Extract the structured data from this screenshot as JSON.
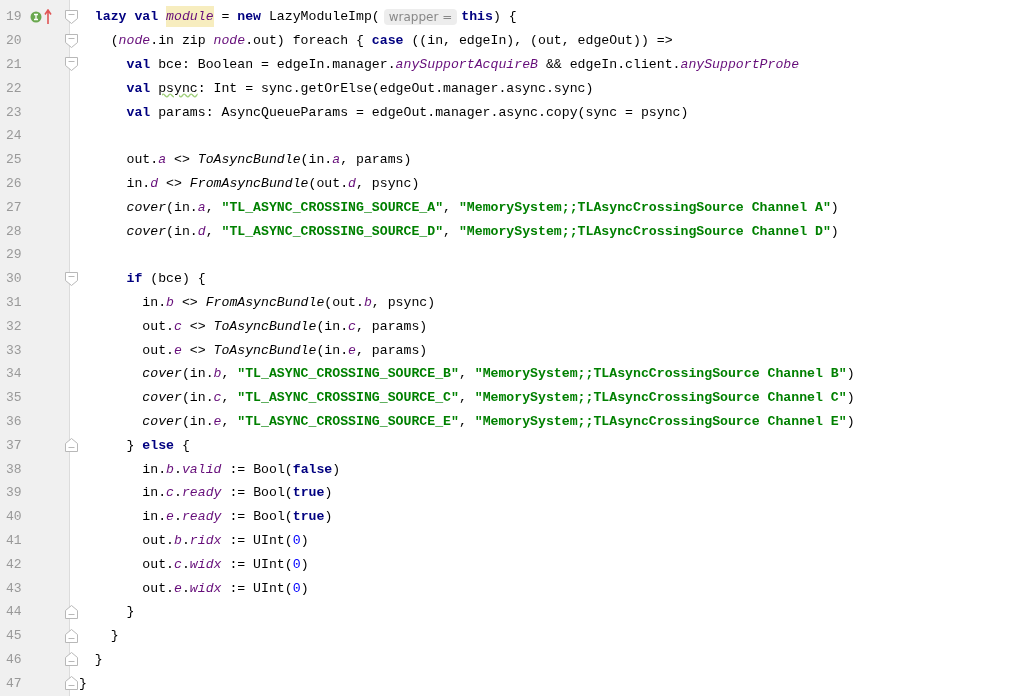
{
  "editor": {
    "lines": [
      {
        "number": "19",
        "fold_start": true,
        "fold_end": false,
        "gutter_icons": [
          {
            "kind": "implemented"
          },
          {
            "kind": "overriding"
          }
        ],
        "tokens": [
          {
            "kind": "keyword",
            "text": "  lazy val "
          },
          {
            "kind": "highlight",
            "text": "module"
          },
          {
            "kind": "plain",
            "text": " = "
          },
          {
            "kind": "keyword",
            "text": "new"
          },
          {
            "kind": "plain",
            "text": " LazyModuleImp("
          },
          {
            "kind": "hint",
            "text": "wrapper ="
          },
          {
            "kind": "keyword",
            "text": "this"
          },
          {
            "kind": "plain",
            "text": ") {"
          }
        ]
      },
      {
        "number": "20",
        "fold_start": true,
        "fold_end": false,
        "tokens": [
          {
            "kind": "plain",
            "text": "    ("
          },
          {
            "kind": "field",
            "text": "node"
          },
          {
            "kind": "plain",
            "text": ".in zip "
          },
          {
            "kind": "field",
            "text": "node"
          },
          {
            "kind": "plain",
            "text": ".out) foreach { "
          },
          {
            "kind": "keyword",
            "text": "case"
          },
          {
            "kind": "plain",
            "text": " ((in, edgeIn), (out, edgeOut)) =>"
          }
        ]
      },
      {
        "number": "21",
        "fold_start": true,
        "fold_end": false,
        "tokens": [
          {
            "kind": "keyword",
            "text": "      val"
          },
          {
            "kind": "plain",
            "text": " bce: Boolean = edgeIn.manager."
          },
          {
            "kind": "field",
            "text": "anySupportAcquireB"
          },
          {
            "kind": "plain",
            "text": " && edgeIn.client."
          },
          {
            "kind": "field",
            "text": "anySupportProbe"
          }
        ]
      },
      {
        "number": "22",
        "fold_start": false,
        "fold_end": false,
        "tokens": [
          {
            "kind": "keyword",
            "text": "      val "
          },
          {
            "kind": "warning",
            "text": "psync"
          },
          {
            "kind": "plain",
            "text": ": Int = sync.getOrElse(edgeOut.manager.async.sync)"
          }
        ]
      },
      {
        "number": "23",
        "fold_start": false,
        "fold_end": false,
        "tokens": [
          {
            "kind": "keyword",
            "text": "      val"
          },
          {
            "kind": "plain",
            "text": " params: AsyncQueueParams = edgeOut.manager.async.copy(sync = psync)"
          }
        ]
      },
      {
        "number": "24",
        "fold_start": false,
        "fold_end": false
      },
      {
        "number": "25",
        "fold_start": false,
        "fold_end": false,
        "tokens": [
          {
            "kind": "plain",
            "text": "      out."
          },
          {
            "kind": "field",
            "text": "a"
          },
          {
            "kind": "plain",
            "text": " <> "
          },
          {
            "kind": "call",
            "text": "ToAsyncBundle"
          },
          {
            "kind": "plain",
            "text": "(in."
          },
          {
            "kind": "field",
            "text": "a"
          },
          {
            "kind": "plain",
            "text": ", params)"
          }
        ]
      },
      {
        "number": "26",
        "fold_start": false,
        "fold_end": false,
        "tokens": [
          {
            "kind": "plain",
            "text": "      in."
          },
          {
            "kind": "field",
            "text": "d"
          },
          {
            "kind": "plain",
            "text": " <> "
          },
          {
            "kind": "call",
            "text": "FromAsyncBundle"
          },
          {
            "kind": "plain",
            "text": "(out."
          },
          {
            "kind": "field",
            "text": "d"
          },
          {
            "kind": "plain",
            "text": ", psync)"
          }
        ]
      },
      {
        "number": "27",
        "fold_start": false,
        "fold_end": false,
        "tokens": [
          {
            "kind": "call",
            "text": "      cover"
          },
          {
            "kind": "plain",
            "text": "(in."
          },
          {
            "kind": "field",
            "text": "a"
          },
          {
            "kind": "plain",
            "text": ", "
          },
          {
            "kind": "string",
            "text": "\"TL_ASYNC_CROSSING_SOURCE_A\""
          },
          {
            "kind": "plain",
            "text": ", "
          },
          {
            "kind": "string",
            "text": "\"MemorySystem;;TLAsyncCrossingSource Channel A\""
          },
          {
            "kind": "plain",
            "text": ")"
          }
        ]
      },
      {
        "number": "28",
        "fold_start": false,
        "fold_end": false,
        "tokens": [
          {
            "kind": "call",
            "text": "      cover"
          },
          {
            "kind": "plain",
            "text": "(in."
          },
          {
            "kind": "field",
            "text": "d"
          },
          {
            "kind": "plain",
            "text": ", "
          },
          {
            "kind": "string",
            "text": "\"TL_ASYNC_CROSSING_SOURCE_D\""
          },
          {
            "kind": "plain",
            "text": ", "
          },
          {
            "kind": "string",
            "text": "\"MemorySystem;;TLAsyncCrossingSource Channel D\""
          },
          {
            "kind": "plain",
            "text": ")"
          }
        ]
      },
      {
        "number": "29",
        "fold_start": false,
        "fold_end": false
      },
      {
        "number": "30",
        "fold_start": true,
        "fold_end": false,
        "tokens": [
          {
            "kind": "keyword",
            "text": "      if"
          },
          {
            "kind": "plain",
            "text": " (bce) {"
          }
        ]
      },
      {
        "number": "31",
        "fold_start": false,
        "fold_end": false,
        "tokens": [
          {
            "kind": "plain",
            "text": "        in."
          },
          {
            "kind": "field",
            "text": "b"
          },
          {
            "kind": "plain",
            "text": " <> "
          },
          {
            "kind": "call",
            "text": "FromAsyncBundle"
          },
          {
            "kind": "plain",
            "text": "(out."
          },
          {
            "kind": "field",
            "text": "b"
          },
          {
            "kind": "plain",
            "text": ", psync)"
          }
        ]
      },
      {
        "number": "32",
        "fold_start": false,
        "fold_end": false,
        "tokens": [
          {
            "kind": "plain",
            "text": "        out."
          },
          {
            "kind": "field",
            "text": "c"
          },
          {
            "kind": "plain",
            "text": " <> "
          },
          {
            "kind": "call",
            "text": "ToAsyncBundle"
          },
          {
            "kind": "plain",
            "text": "(in."
          },
          {
            "kind": "field",
            "text": "c"
          },
          {
            "kind": "plain",
            "text": ", params)"
          }
        ]
      },
      {
        "number": "33",
        "fold_start": false,
        "fold_end": false,
        "tokens": [
          {
            "kind": "plain",
            "text": "        out."
          },
          {
            "kind": "field",
            "text": "e"
          },
          {
            "kind": "plain",
            "text": " <> "
          },
          {
            "kind": "call",
            "text": "ToAsyncBundle"
          },
          {
            "kind": "plain",
            "text": "(in."
          },
          {
            "kind": "field",
            "text": "e"
          },
          {
            "kind": "plain",
            "text": ", params)"
          }
        ]
      },
      {
        "number": "34",
        "fold_start": false,
        "fold_end": false,
        "tokens": [
          {
            "kind": "call",
            "text": "        cover"
          },
          {
            "kind": "plain",
            "text": "(in."
          },
          {
            "kind": "field",
            "text": "b"
          },
          {
            "kind": "plain",
            "text": ", "
          },
          {
            "kind": "string",
            "text": "\"TL_ASYNC_CROSSING_SOURCE_B\""
          },
          {
            "kind": "plain",
            "text": ", "
          },
          {
            "kind": "string",
            "text": "\"MemorySystem;;TLAsyncCrossingSource Channel B\""
          },
          {
            "kind": "plain",
            "text": ")"
          }
        ]
      },
      {
        "number": "35",
        "fold_start": false,
        "fold_end": false,
        "tokens": [
          {
            "kind": "call",
            "text": "        cover"
          },
          {
            "kind": "plain",
            "text": "(in."
          },
          {
            "kind": "field",
            "text": "c"
          },
          {
            "kind": "plain",
            "text": ", "
          },
          {
            "kind": "string",
            "text": "\"TL_ASYNC_CROSSING_SOURCE_C\""
          },
          {
            "kind": "plain",
            "text": ", "
          },
          {
            "kind": "string",
            "text": "\"MemorySystem;;TLAsyncCrossingSource Channel C\""
          },
          {
            "kind": "plain",
            "text": ")"
          }
        ]
      },
      {
        "number": "36",
        "fold_start": false,
        "fold_end": false,
        "tokens": [
          {
            "kind": "call",
            "text": "        cover"
          },
          {
            "kind": "plain",
            "text": "(in."
          },
          {
            "kind": "field",
            "text": "e"
          },
          {
            "kind": "plain",
            "text": ", "
          },
          {
            "kind": "string",
            "text": "\"TL_ASYNC_CROSSING_SOURCE_E\""
          },
          {
            "kind": "plain",
            "text": ", "
          },
          {
            "kind": "string",
            "text": "\"MemorySystem;;TLAsyncCrossingSource Channel E\""
          },
          {
            "kind": "plain",
            "text": ")"
          }
        ]
      },
      {
        "number": "37",
        "fold_start": false,
        "fold_end": true,
        "tokens": [
          {
            "kind": "plain",
            "text": "      } "
          },
          {
            "kind": "keyword",
            "text": "else"
          },
          {
            "kind": "plain",
            "text": " {"
          }
        ]
      },
      {
        "number": "38",
        "fold_start": false,
        "fold_end": false,
        "tokens": [
          {
            "kind": "plain",
            "text": "        in."
          },
          {
            "kind": "field",
            "text": "b"
          },
          {
            "kind": "plain",
            "text": "."
          },
          {
            "kind": "field",
            "text": "valid"
          },
          {
            "kind": "plain",
            "text": " := Bool("
          },
          {
            "kind": "keyword",
            "text": "false"
          },
          {
            "kind": "plain",
            "text": ")"
          }
        ]
      },
      {
        "number": "39",
        "fold_start": false,
        "fold_end": false,
        "tokens": [
          {
            "kind": "plain",
            "text": "        in."
          },
          {
            "kind": "field",
            "text": "c"
          },
          {
            "kind": "plain",
            "text": "."
          },
          {
            "kind": "field",
            "text": "ready"
          },
          {
            "kind": "plain",
            "text": " := Bool("
          },
          {
            "kind": "keyword",
            "text": "true"
          },
          {
            "kind": "plain",
            "text": ")"
          }
        ]
      },
      {
        "number": "40",
        "fold_start": false,
        "fold_end": false,
        "tokens": [
          {
            "kind": "plain",
            "text": "        in."
          },
          {
            "kind": "field",
            "text": "e"
          },
          {
            "kind": "plain",
            "text": "."
          },
          {
            "kind": "field",
            "text": "ready"
          },
          {
            "kind": "plain",
            "text": " := Bool("
          },
          {
            "kind": "keyword",
            "text": "true"
          },
          {
            "kind": "plain",
            "text": ")"
          }
        ]
      },
      {
        "number": "41",
        "fold_start": false,
        "fold_end": false,
        "tokens": [
          {
            "kind": "plain",
            "text": "        out."
          },
          {
            "kind": "field",
            "text": "b"
          },
          {
            "kind": "plain",
            "text": "."
          },
          {
            "kind": "field",
            "text": "ridx"
          },
          {
            "kind": "plain",
            "text": " := UInt("
          },
          {
            "kind": "number",
            "text": "0"
          },
          {
            "kind": "plain",
            "text": ")"
          }
        ]
      },
      {
        "number": "42",
        "fold_start": false,
        "fold_end": false,
        "tokens": [
          {
            "kind": "plain",
            "text": "        out."
          },
          {
            "kind": "field",
            "text": "c"
          },
          {
            "kind": "plain",
            "text": "."
          },
          {
            "kind": "field",
            "text": "widx"
          },
          {
            "kind": "plain",
            "text": " := UInt("
          },
          {
            "kind": "number",
            "text": "0"
          },
          {
            "kind": "plain",
            "text": ")"
          }
        ]
      },
      {
        "number": "43",
        "fold_start": false,
        "fold_end": false,
        "tokens": [
          {
            "kind": "plain",
            "text": "        out."
          },
          {
            "kind": "field",
            "text": "e"
          },
          {
            "kind": "plain",
            "text": "."
          },
          {
            "kind": "field",
            "text": "widx"
          },
          {
            "kind": "plain",
            "text": " := UInt("
          },
          {
            "kind": "number",
            "text": "0"
          },
          {
            "kind": "plain",
            "text": ")"
          }
        ]
      },
      {
        "number": "44",
        "fold_start": false,
        "fold_end": true,
        "tokens": [
          {
            "kind": "plain",
            "text": "      }"
          }
        ]
      },
      {
        "number": "45",
        "fold_start": false,
        "fold_end": true,
        "tokens": [
          {
            "kind": "plain",
            "text": "    }"
          }
        ]
      },
      {
        "number": "46",
        "fold_start": false,
        "fold_end": true,
        "tokens": [
          {
            "kind": "plain",
            "text": "  }"
          }
        ]
      },
      {
        "number": "47",
        "fold_start": false,
        "fold_end": true,
        "tokens": [
          {
            "kind": "plain",
            "text": "}"
          }
        ]
      }
    ]
  }
}
